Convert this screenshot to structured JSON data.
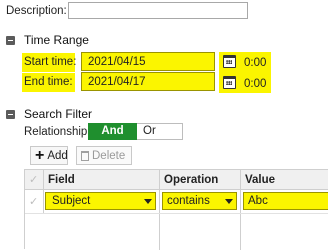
{
  "description": {
    "label": "Description:",
    "value": ""
  },
  "time_range": {
    "header": "Time Range",
    "start_label": "Start time:",
    "start_date": "2021/04/15",
    "start_time": "0:00",
    "end_label": "End time:",
    "end_date": "2021/04/17",
    "end_time": "0:00"
  },
  "search_filter": {
    "header": "Search Filter",
    "relationship_label": "Relationship",
    "toggle_on": "And",
    "toggle_off": "Or",
    "add_label": "Add",
    "delete_label": "Delete",
    "columns": [
      "Field",
      "Operation",
      "Value"
    ],
    "rows": [
      {
        "field": "Subject",
        "operation": "contains",
        "value": "Abc"
      }
    ]
  },
  "colors": {
    "highlight": "#fbf500",
    "toggle_green": "#1f8f2e"
  }
}
